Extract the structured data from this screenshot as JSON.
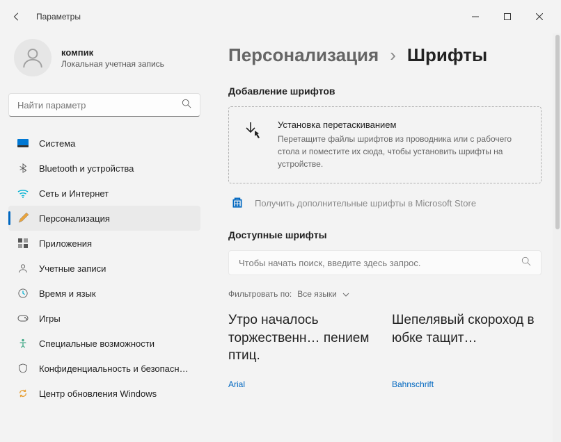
{
  "window": {
    "title": "Параметры"
  },
  "user": {
    "name": "компик",
    "sub": "Локальная учетная запись"
  },
  "search": {
    "placeholder": "Найти параметр"
  },
  "nav": [
    {
      "label": "Система"
    },
    {
      "label": "Bluetooth и устройства"
    },
    {
      "label": "Сеть и Интернет"
    },
    {
      "label": "Персонализация"
    },
    {
      "label": "Приложения"
    },
    {
      "label": "Учетные записи"
    },
    {
      "label": "Время и язык"
    },
    {
      "label": "Игры"
    },
    {
      "label": "Специальные возможности"
    },
    {
      "label": "Конфиденциальность и безопасность"
    },
    {
      "label": "Центр обновления Windows"
    }
  ],
  "breadcrumb": {
    "parent": "Персонализация",
    "sep": "›",
    "current": "Шрифты"
  },
  "add": {
    "heading": "Добавление шрифтов",
    "drop_title": "Установка перетаскиванием",
    "drop_desc": "Перетащите файлы шрифтов из проводника или с рабочего стола и поместите их сюда, чтобы установить шрифты на устройстве.",
    "store": "Получить дополнительные шрифты в Microsoft Store"
  },
  "available": {
    "heading": "Доступные шрифты",
    "search_placeholder": "Чтобы начать поиск, введите здесь запрос.",
    "filter_label": "Фильтровать по:",
    "filter_value": "Все языки"
  },
  "fonts": [
    {
      "sample": "Утро началось торжественн… пением птиц.",
      "name": "Arial"
    },
    {
      "sample": "Шепелявый скороход в юбке тащит…",
      "name": "Bahnschrift"
    }
  ]
}
